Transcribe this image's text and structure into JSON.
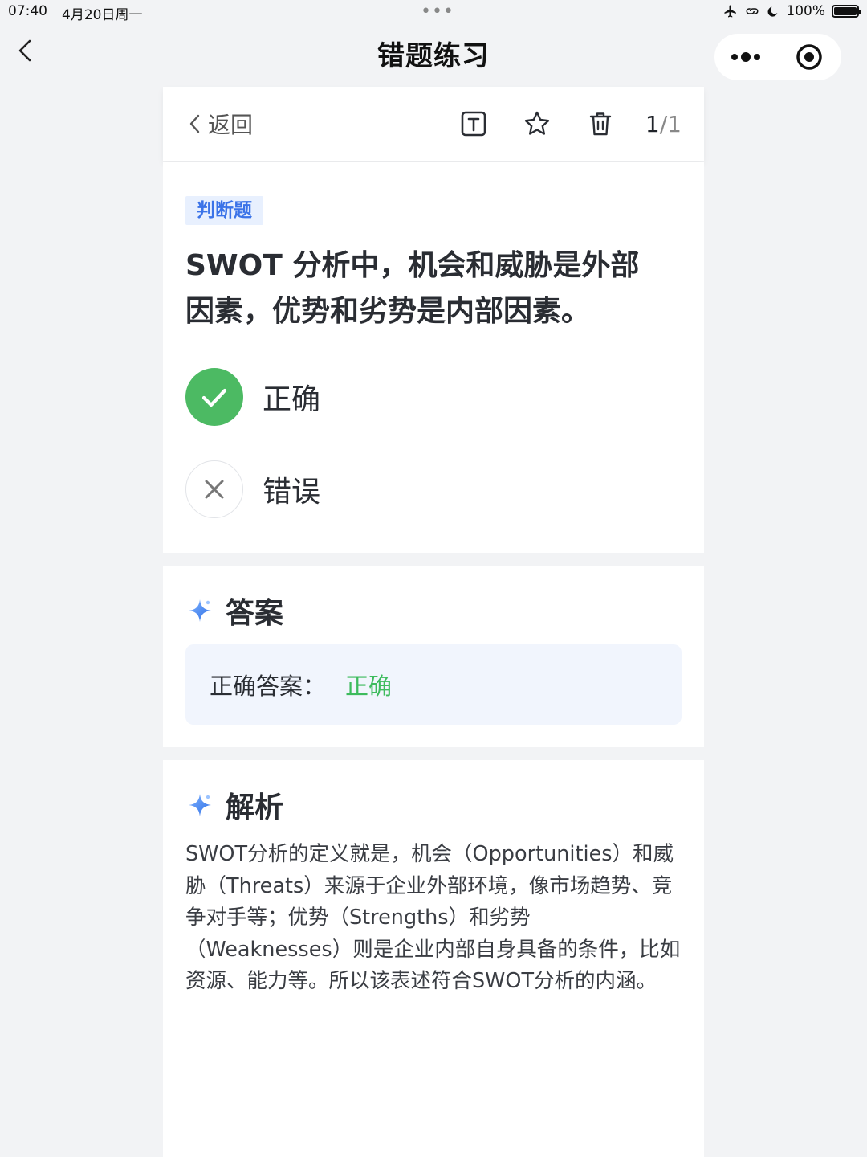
{
  "status_bar": {
    "time": "07:40",
    "date": "4月20日周一",
    "battery": "100%",
    "battery_level": 1.0
  },
  "nav": {
    "title": "错题练习"
  },
  "toolbar": {
    "back_label": "返回",
    "current": "1",
    "total": "/1"
  },
  "question": {
    "type_tag": "判断题",
    "text": "SWOT 分析中，机会和威胁是外部因素，优势和劣势是内部因素。",
    "options": [
      {
        "label": "正确",
        "selected": true,
        "icon": "check-icon"
      },
      {
        "label": "错误",
        "selected": false,
        "icon": "cross-icon"
      }
    ]
  },
  "answer": {
    "section_title": "答案",
    "label": "正确答案：",
    "value": "正确"
  },
  "analysis": {
    "section_title": "解析",
    "text": "SWOT分析的定义就是，机会（Opportunities）和威胁（Threats）来源于企业外部环境，像市场趋势、竞争对手等；优势（Strengths）和劣势（Weaknesses）则是企业内部自身具备的条件，比如资源、能力等。所以该表述符合SWOT分析的内涵。"
  },
  "colors": {
    "correct_green": "#4cba63",
    "tag_blue": "#3b73e8",
    "answer_green": "#3dbb5d",
    "answer_bg": "#f1f5fd"
  }
}
